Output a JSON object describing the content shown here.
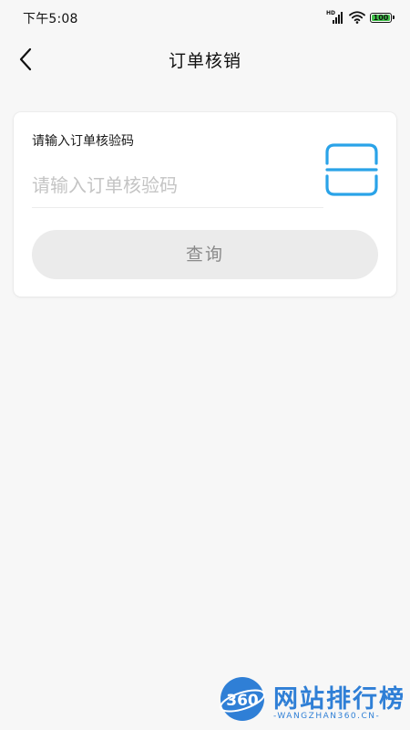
{
  "status_bar": {
    "time": "下午5:08",
    "signal_label": "HD",
    "battery_level": "100"
  },
  "header": {
    "title": "订单核销",
    "back_icon": "chevron-left-icon"
  },
  "verify_card": {
    "field_label": "请输入订单核验码",
    "input_value": "",
    "input_placeholder": "请输入订单核验码",
    "scan_icon": "scan-icon",
    "query_button_label": "查询"
  },
  "watermark": {
    "logo_text": "360",
    "title": "网站排行榜",
    "subtitle": "-WANGZHAN360.CN-"
  },
  "colors": {
    "accent": "#2aa3e8",
    "button_bg": "#ebebeb",
    "button_text": "#8a8a8a",
    "placeholder": "#c4c4c4",
    "battery": "#41c24a",
    "watermark": "#2f7fd6"
  }
}
